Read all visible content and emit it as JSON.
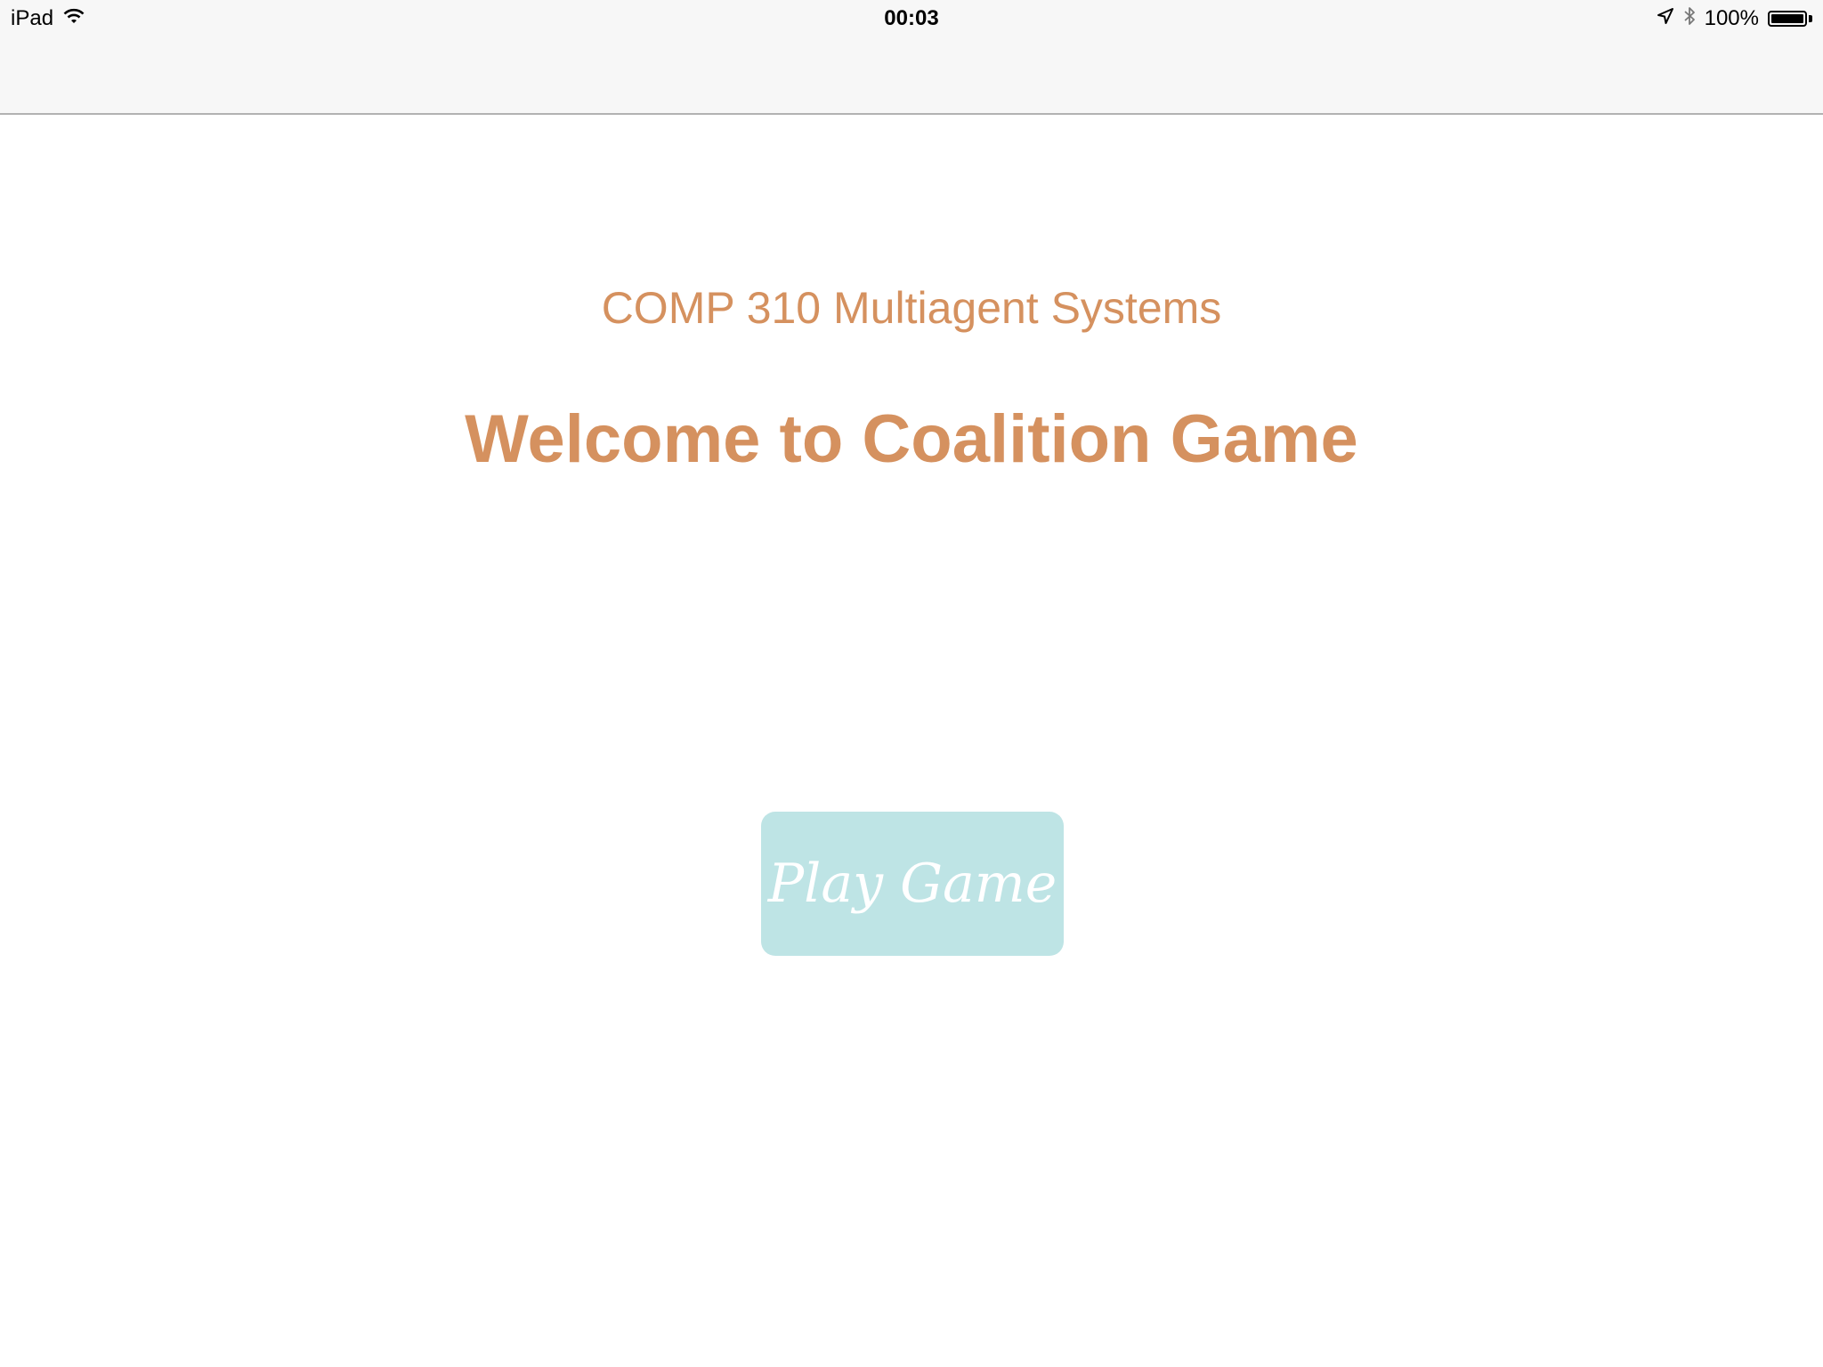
{
  "status_bar": {
    "device": "iPad",
    "time": "00:03",
    "battery_text": "100%",
    "battery_level": 1.0,
    "icons": [
      "wifi-icon",
      "location-arrow-icon",
      "bluetooth-icon",
      "battery-icon"
    ]
  },
  "main": {
    "subtitle": "COMP 310 Multiagent Systems",
    "title": "Welcome to Coalition Game",
    "play_button_label": "Play Game"
  },
  "colors": {
    "accent_text": "#d5915f",
    "button_bg": "#bee4e5",
    "button_text": "#ffffff",
    "bar_bg": "#f7f7f7"
  }
}
